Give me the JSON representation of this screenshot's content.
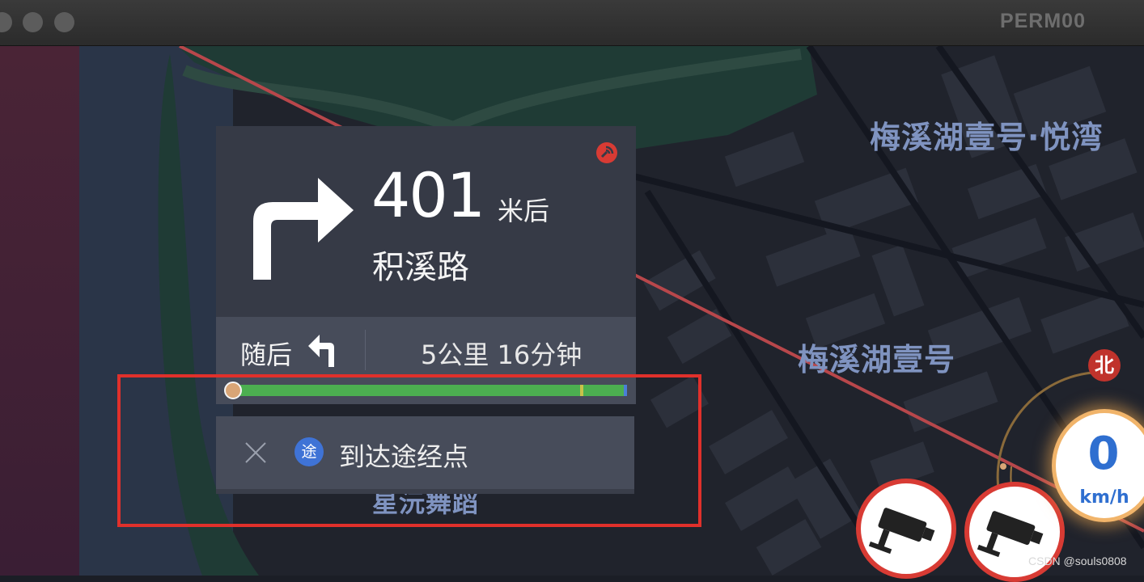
{
  "window": {
    "title": "PERM00"
  },
  "map": {
    "labels": [
      "梅溪湖壹号·悦湾",
      "梅溪湖壹号",
      "星沅舞蹈"
    ]
  },
  "navigation": {
    "maneuver": {
      "icon": "turn-right-arrow-icon",
      "distance": "401",
      "distance_unit": "米后",
      "road": "积溪路"
    },
    "next": {
      "label": "随后",
      "icon": "turn-left-arrow-icon"
    },
    "remaining": "5公里 16分钟",
    "progress": {
      "traveled_fraction": 0.0,
      "colors": {
        "clear": "#4caf50",
        "slow": "#c9c24a",
        "end": "#4a7fd8"
      }
    },
    "waypoint": {
      "badge": "途",
      "label": "到达途经点",
      "close_icon": "close-icon"
    },
    "gps_icon": "satellite-signal-icon"
  },
  "compass": {
    "label": "北"
  },
  "speed": {
    "value": "0",
    "unit": "km/h"
  },
  "cameras": [
    "traffic-camera-icon",
    "traffic-camera-icon"
  ],
  "watermark": "CSDN @souls0808",
  "colors": {
    "highlight": "#e0302b",
    "panel": "#363a46",
    "accent": "#3f73d6"
  }
}
